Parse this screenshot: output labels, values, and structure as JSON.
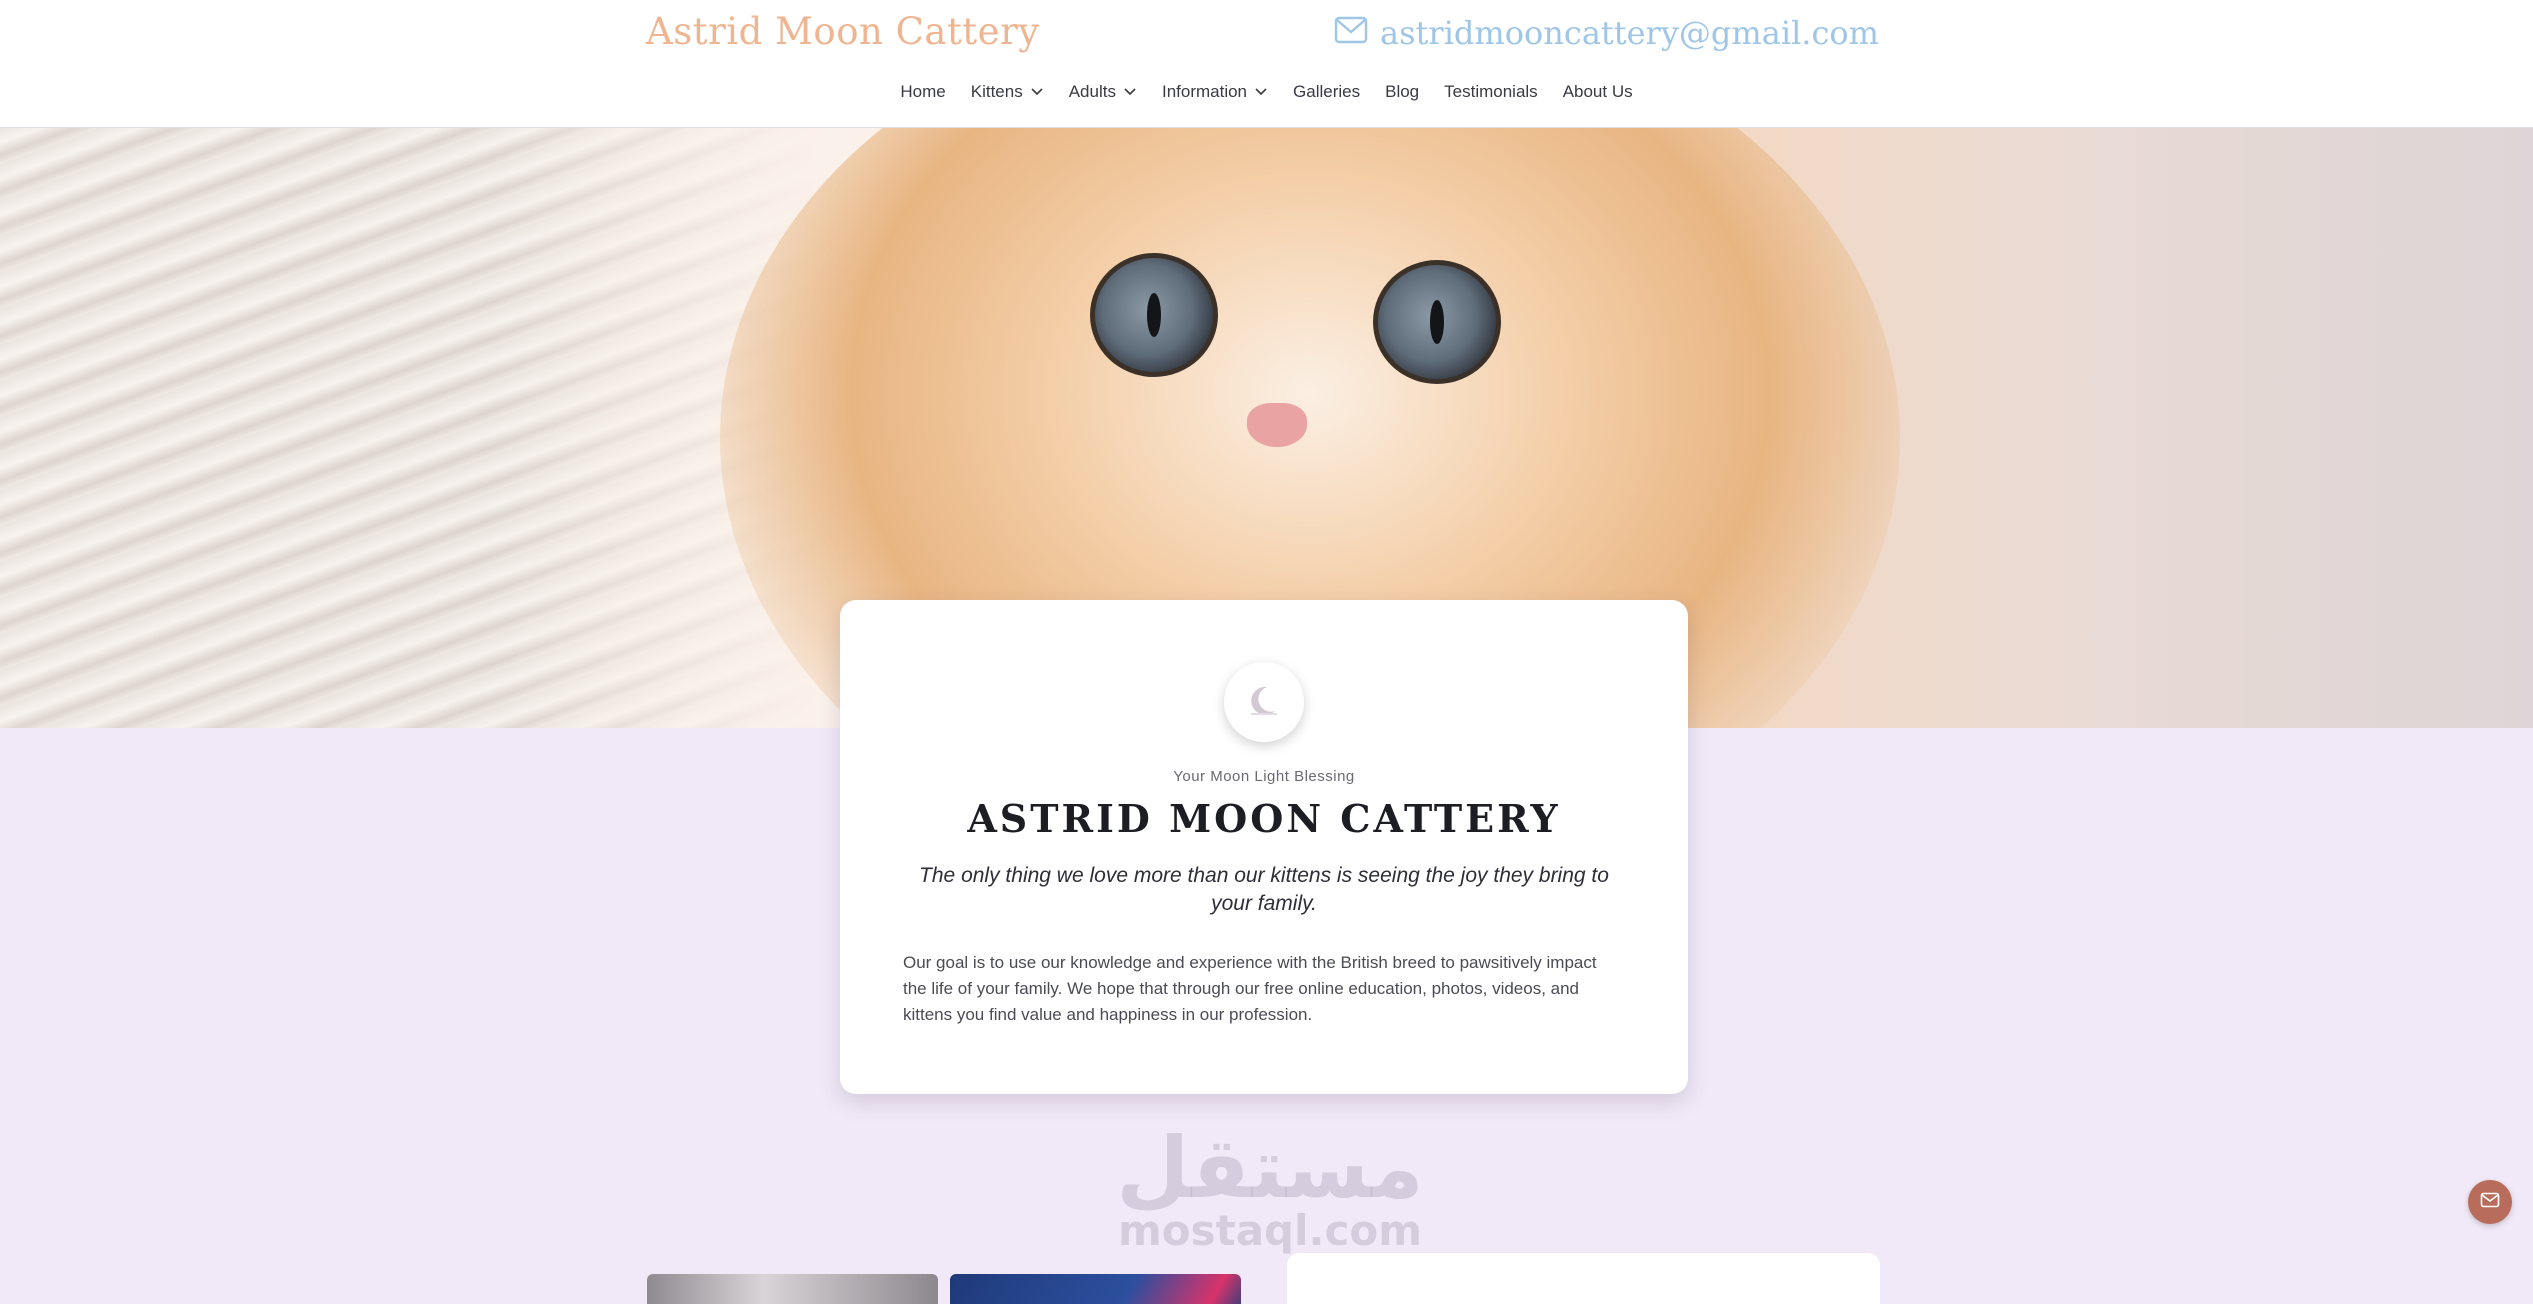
{
  "header": {
    "brand": "Astrid Moon Cattery",
    "email": "astridmooncattery@gmail.com",
    "email_icon": "mail-icon"
  },
  "nav": {
    "items": [
      {
        "label": "Home",
        "dropdown": false
      },
      {
        "label": "Kittens",
        "dropdown": true
      },
      {
        "label": "Adults",
        "dropdown": true
      },
      {
        "label": "Information",
        "dropdown": true
      },
      {
        "label": "Galleries",
        "dropdown": false
      },
      {
        "label": "Blog",
        "dropdown": false
      },
      {
        "label": "Testimonials",
        "dropdown": false
      },
      {
        "label": "About Us",
        "dropdown": false
      }
    ]
  },
  "hero": {
    "image": "kitten-photo"
  },
  "intro_card": {
    "logo": "moon-logo",
    "tagline": "Your Moon Light Blessing",
    "title": "ASTRID MOON CATTERY",
    "quote": "The only thing we love more than our kittens is seeing the joy they bring to your family.",
    "description": "Our goal is to use our knowledge and experience with the British breed to pawsitively impact the life of your family. We hope that through our free online education, photos, videos, and kittens you find value and happiness in our profession."
  },
  "watermark": {
    "arabic": "مستقل",
    "latin": "mostaql.com"
  },
  "floating_button": {
    "icon": "mail-icon"
  },
  "colors": {
    "brand": "#efb591",
    "email": "#9fc6e6",
    "background": "#f1e9f7",
    "fab": "#b86c5c"
  }
}
